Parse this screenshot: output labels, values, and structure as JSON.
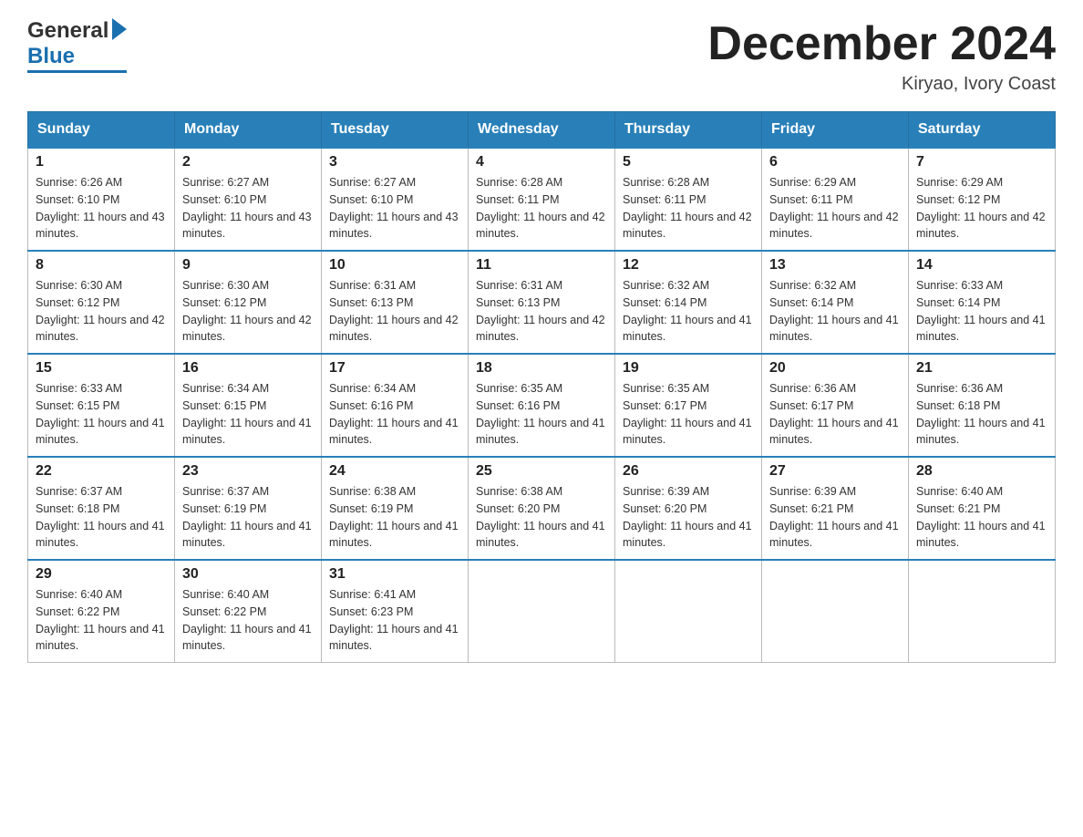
{
  "header": {
    "logo_general": "General",
    "logo_blue": "Blue",
    "month_title": "December 2024",
    "location": "Kiryao, Ivory Coast"
  },
  "calendar": {
    "days_of_week": [
      "Sunday",
      "Monday",
      "Tuesday",
      "Wednesday",
      "Thursday",
      "Friday",
      "Saturday"
    ],
    "weeks": [
      [
        {
          "date": "1",
          "sunrise": "6:26 AM",
          "sunset": "6:10 PM",
          "daylight": "11 hours and 43 minutes."
        },
        {
          "date": "2",
          "sunrise": "6:27 AM",
          "sunset": "6:10 PM",
          "daylight": "11 hours and 43 minutes."
        },
        {
          "date": "3",
          "sunrise": "6:27 AM",
          "sunset": "6:10 PM",
          "daylight": "11 hours and 43 minutes."
        },
        {
          "date": "4",
          "sunrise": "6:28 AM",
          "sunset": "6:11 PM",
          "daylight": "11 hours and 42 minutes."
        },
        {
          "date": "5",
          "sunrise": "6:28 AM",
          "sunset": "6:11 PM",
          "daylight": "11 hours and 42 minutes."
        },
        {
          "date": "6",
          "sunrise": "6:29 AM",
          "sunset": "6:11 PM",
          "daylight": "11 hours and 42 minutes."
        },
        {
          "date": "7",
          "sunrise": "6:29 AM",
          "sunset": "6:12 PM",
          "daylight": "11 hours and 42 minutes."
        }
      ],
      [
        {
          "date": "8",
          "sunrise": "6:30 AM",
          "sunset": "6:12 PM",
          "daylight": "11 hours and 42 minutes."
        },
        {
          "date": "9",
          "sunrise": "6:30 AM",
          "sunset": "6:12 PM",
          "daylight": "11 hours and 42 minutes."
        },
        {
          "date": "10",
          "sunrise": "6:31 AM",
          "sunset": "6:13 PM",
          "daylight": "11 hours and 42 minutes."
        },
        {
          "date": "11",
          "sunrise": "6:31 AM",
          "sunset": "6:13 PM",
          "daylight": "11 hours and 42 minutes."
        },
        {
          "date": "12",
          "sunrise": "6:32 AM",
          "sunset": "6:14 PM",
          "daylight": "11 hours and 41 minutes."
        },
        {
          "date": "13",
          "sunrise": "6:32 AM",
          "sunset": "6:14 PM",
          "daylight": "11 hours and 41 minutes."
        },
        {
          "date": "14",
          "sunrise": "6:33 AM",
          "sunset": "6:14 PM",
          "daylight": "11 hours and 41 minutes."
        }
      ],
      [
        {
          "date": "15",
          "sunrise": "6:33 AM",
          "sunset": "6:15 PM",
          "daylight": "11 hours and 41 minutes."
        },
        {
          "date": "16",
          "sunrise": "6:34 AM",
          "sunset": "6:15 PM",
          "daylight": "11 hours and 41 minutes."
        },
        {
          "date": "17",
          "sunrise": "6:34 AM",
          "sunset": "6:16 PM",
          "daylight": "11 hours and 41 minutes."
        },
        {
          "date": "18",
          "sunrise": "6:35 AM",
          "sunset": "6:16 PM",
          "daylight": "11 hours and 41 minutes."
        },
        {
          "date": "19",
          "sunrise": "6:35 AM",
          "sunset": "6:17 PM",
          "daylight": "11 hours and 41 minutes."
        },
        {
          "date": "20",
          "sunrise": "6:36 AM",
          "sunset": "6:17 PM",
          "daylight": "11 hours and 41 minutes."
        },
        {
          "date": "21",
          "sunrise": "6:36 AM",
          "sunset": "6:18 PM",
          "daylight": "11 hours and 41 minutes."
        }
      ],
      [
        {
          "date": "22",
          "sunrise": "6:37 AM",
          "sunset": "6:18 PM",
          "daylight": "11 hours and 41 minutes."
        },
        {
          "date": "23",
          "sunrise": "6:37 AM",
          "sunset": "6:19 PM",
          "daylight": "11 hours and 41 minutes."
        },
        {
          "date": "24",
          "sunrise": "6:38 AM",
          "sunset": "6:19 PM",
          "daylight": "11 hours and 41 minutes."
        },
        {
          "date": "25",
          "sunrise": "6:38 AM",
          "sunset": "6:20 PM",
          "daylight": "11 hours and 41 minutes."
        },
        {
          "date": "26",
          "sunrise": "6:39 AM",
          "sunset": "6:20 PM",
          "daylight": "11 hours and 41 minutes."
        },
        {
          "date": "27",
          "sunrise": "6:39 AM",
          "sunset": "6:21 PM",
          "daylight": "11 hours and 41 minutes."
        },
        {
          "date": "28",
          "sunrise": "6:40 AM",
          "sunset": "6:21 PM",
          "daylight": "11 hours and 41 minutes."
        }
      ],
      [
        {
          "date": "29",
          "sunrise": "6:40 AM",
          "sunset": "6:22 PM",
          "daylight": "11 hours and 41 minutes."
        },
        {
          "date": "30",
          "sunrise": "6:40 AM",
          "sunset": "6:22 PM",
          "daylight": "11 hours and 41 minutes."
        },
        {
          "date": "31",
          "sunrise": "6:41 AM",
          "sunset": "6:23 PM",
          "daylight": "11 hours and 41 minutes."
        },
        null,
        null,
        null,
        null
      ]
    ]
  }
}
